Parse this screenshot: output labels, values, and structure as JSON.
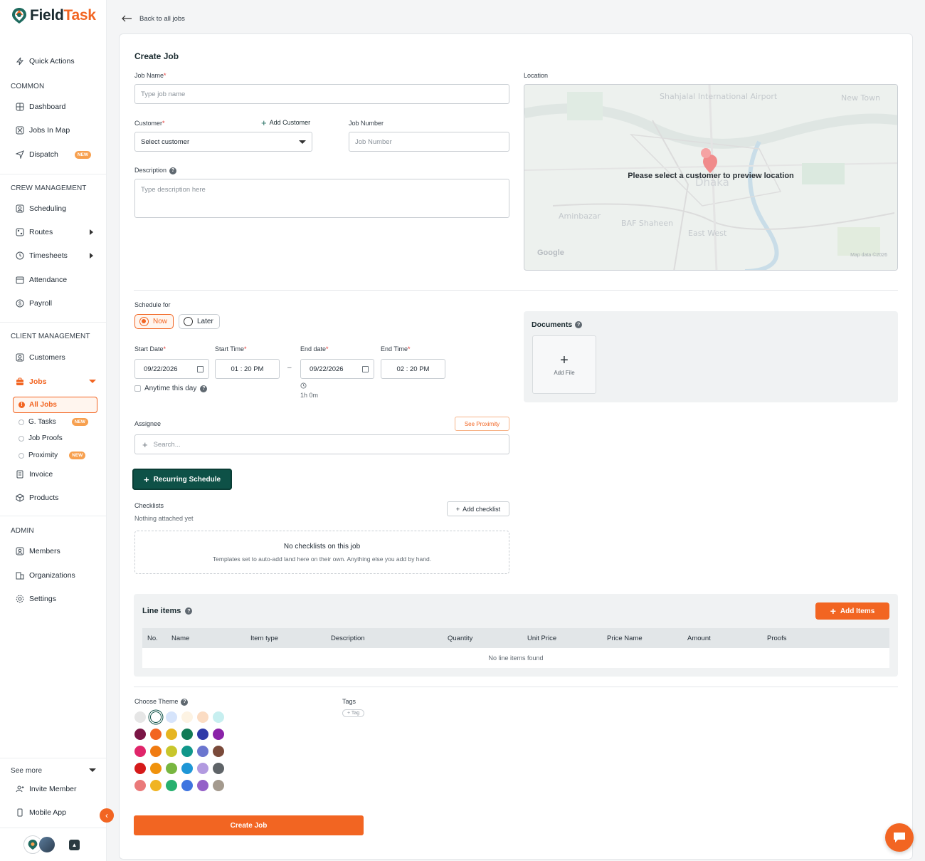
{
  "brand": {
    "name_part1": "Field",
    "name_part2": "Task"
  },
  "sidebar": {
    "quick_actions": "Quick Actions",
    "sections": {
      "common": "COMMON",
      "crew": "CREW MANAGEMENT",
      "client": "CLIENT MANAGEMENT",
      "admin": "ADMIN"
    },
    "common_items": [
      "Dashboard",
      "Jobs In Map",
      "Dispatch"
    ],
    "crew_items": [
      "Scheduling",
      "Routes",
      "Timesheets",
      "Attendance",
      "Payroll"
    ],
    "client_items": [
      "Customers",
      "Jobs",
      "Invoice",
      "Products"
    ],
    "jobs_sub": [
      "All Jobs",
      "G. Tasks",
      "Job Proofs",
      "Proximity"
    ],
    "admin_items": [
      "Members",
      "Organizations",
      "Settings"
    ],
    "see_more": "See more",
    "bottom_items": [
      "Invite Member",
      "Mobile App"
    ],
    "new_badge": "NEW"
  },
  "header": {
    "back_label": "Back to all jobs"
  },
  "form": {
    "title": "Create Job",
    "job_name_label": "Job Name",
    "job_name_placeholder": "Type job name",
    "customer_label": "Customer",
    "add_customer": "Add Customer",
    "customer_select": "Select customer",
    "job_number_label": "Job Number",
    "job_number_placeholder": "Job Number",
    "description_label": "Description",
    "description_placeholder": "Type description here",
    "location_label": "Location",
    "map_message": "Please select a customer to preview location",
    "map_google": "Google",
    "map_data": "Map data ©2026",
    "schedule_label": "Schedule for",
    "schedule_now": "Now",
    "schedule_later": "Later",
    "start_date_label": "Start Date",
    "start_date": "09/22/2026",
    "start_time_label": "Start Time",
    "start_time": "01 : 20  PM",
    "end_date_label": "End date",
    "end_date": "09/22/2026",
    "end_time_label": "End Time",
    "end_time": "02 : 20  PM",
    "range_sep": "–",
    "duration": "1h 0m",
    "anytime_label": "Anytime this day",
    "assignee_label": "Assignee",
    "see_proximity": "See Proximity",
    "assignee_search": "Search...",
    "recurring_schedule": "Recurring Schedule",
    "checklists_label": "Checklists",
    "nothing_attached": "Nothing attached yet",
    "add_checklist": "Add checklist",
    "no_checklists_title": "No checklists on this job",
    "no_checklists_sub": "Templates set to auto-add land here on their own. Anything else you add by hand.",
    "documents_label": "Documents",
    "add_file": "Add File",
    "line_items_label": "Line items",
    "add_items": "Add Items",
    "columns": [
      "No.",
      "Name",
      "Item type",
      "Description",
      "Quantity",
      "Unit Price",
      "Price Name",
      "Amount",
      "Proofs"
    ],
    "no_line_items": "No line items found",
    "theme_label": "Choose Theme",
    "tags_label": "Tags",
    "tag_add": "+ Tag",
    "create_button": "Create Job"
  },
  "theme_colors": [
    [
      "#e6e6e6",
      "#ffffff",
      "#d6e4fb",
      "#fdf3e3",
      "#fbdcc3",
      "#c7eff0"
    ],
    [
      "#7a1545",
      "#f26522",
      "#e6b521",
      "#117a55",
      "#2f3aa8",
      "#8a22a8"
    ],
    [
      "#e0256a",
      "#f07b12",
      "#c8c62c",
      "#10978a",
      "#6b76cf",
      "#7a4a3a"
    ],
    [
      "#d51a1a",
      "#f0920c",
      "#78b640",
      "#1e96d6",
      "#b29ae0",
      "#5f6468"
    ],
    [
      "#ea7a7a",
      "#f0b423",
      "#27b06f",
      "#3e74e0",
      "#9460c8",
      "#a49a8e"
    ]
  ],
  "colors": {
    "accent": "#f26522",
    "primary_dark": "#0e5147"
  }
}
